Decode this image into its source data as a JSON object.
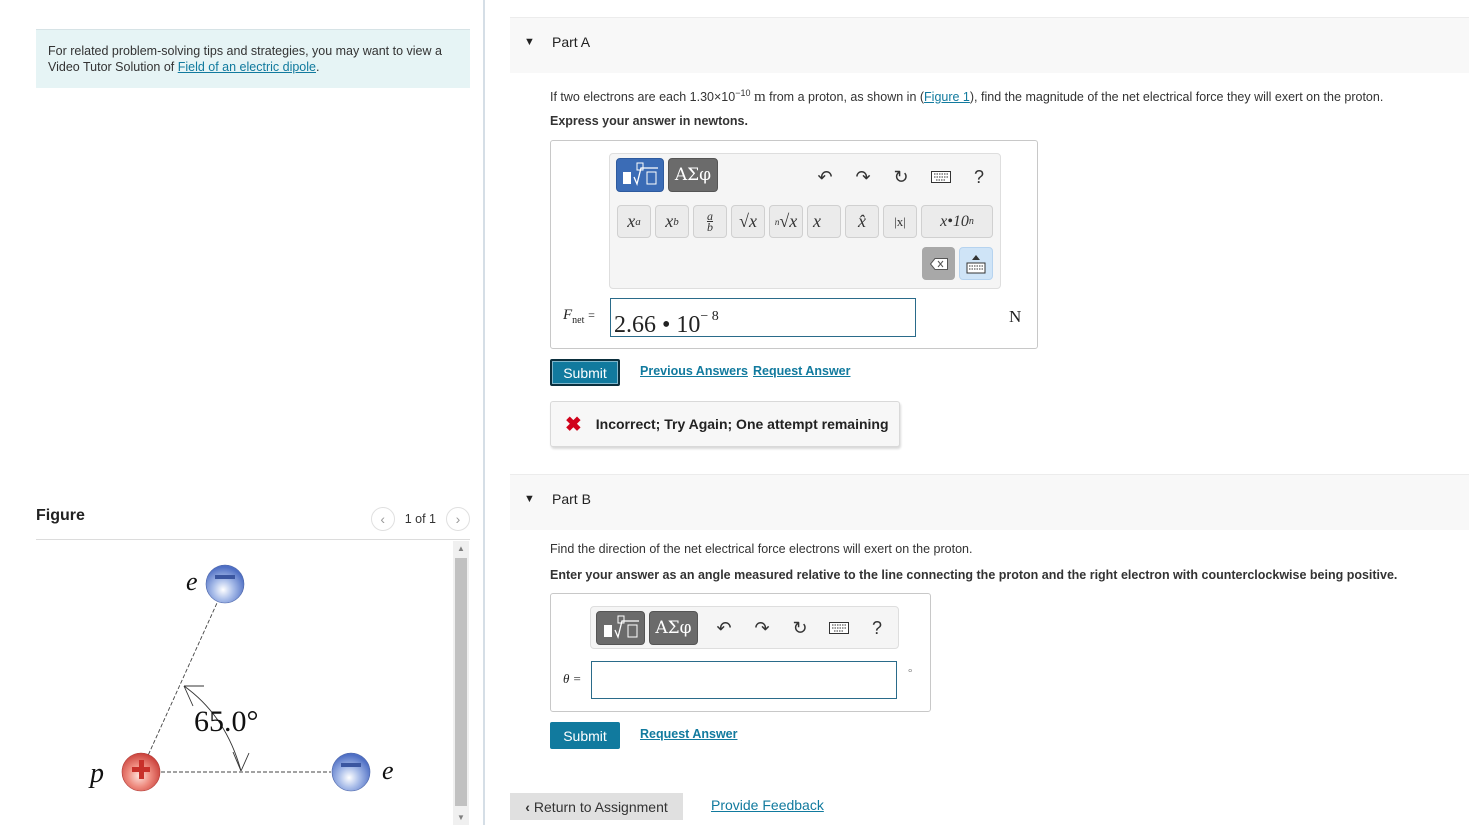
{
  "tip": {
    "text_prefix": "For related problem-solving tips and strategies, you may want to view a Video Tutor Solution of ",
    "link": "Field of an electric dipole",
    "text_suffix": "."
  },
  "figure": {
    "title": "Figure",
    "page": "1 of 1",
    "prev_icon": "chevron-left-icon",
    "next_icon": "chevron-right-icon",
    "labels": {
      "proton": "p",
      "electron_top": "e",
      "electron_right": "e",
      "angle": "65.0°"
    },
    "charges": {
      "proton": "+",
      "electron": "−"
    },
    "colors": {
      "proton": "#d9534f",
      "electron": "#5b7fcf"
    }
  },
  "partA": {
    "title": "Part A",
    "question_prefix": "If two electrons are each 1.30×10",
    "question_exp": "−10",
    "question_unit": "m",
    "question_mid": " from a proton, as shown in (",
    "question_link": "Figure 1",
    "question_suffix": "), find the magnitude of the net electrical force they will exert on the proton.",
    "instruction": "Express your answer in newtons.",
    "toolbar": {
      "templates_label": "▪∜▫",
      "greek_label": "ΑΣφ",
      "icons": [
        "undo-icon",
        "redo-icon",
        "reset-icon",
        "keyboard-icon",
        "help-icon"
      ],
      "help": "?",
      "symbols": [
        "xᵃ",
        "x_b",
        "a/b",
        "√x",
        "ⁿ√x",
        "x⃗",
        "x̂",
        "|x|",
        "x·10ⁿ"
      ]
    },
    "variable": "F",
    "variable_sub": "net",
    "equals": "=",
    "answer_mantissa": "2.66 • 10",
    "answer_exp": "− 8",
    "unit": "N",
    "submit": "Submit",
    "previous_answers": "Previous Answers",
    "request_answer": "Request Answer",
    "feedback": "Incorrect; Try Again; One attempt remaining",
    "feedback_color": "#d0021b"
  },
  "partB": {
    "title": "Part B",
    "question": "Find the direction of the net electrical force electrons will exert on the proton.",
    "instruction": "Enter your answer as an angle measured relative to the line connecting the proton and the right electron with counterclockwise being positive.",
    "toolbar": {
      "templates_label": "▪∜▫",
      "greek_label": "ΑΣφ",
      "help": "?"
    },
    "variable": "θ =",
    "answer_value": "",
    "unit": "°",
    "submit": "Submit",
    "request_answer": "Request Answer"
  },
  "footer": {
    "return_label": "Return to Assignment",
    "feedback_link": "Provide Feedback"
  },
  "colors": {
    "accent": "#117a9e",
    "tip_bg": "#e6f4f5",
    "header_bg": "#f8f8f8"
  }
}
